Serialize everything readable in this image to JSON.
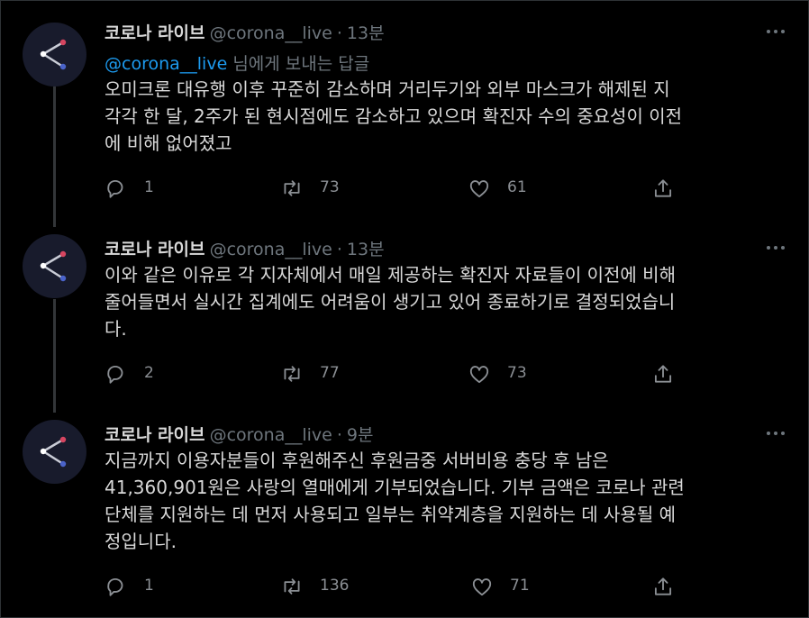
{
  "tweets": [
    {
      "name": "코로나 라이브",
      "handle": "@corona__live",
      "separator": "·",
      "time": "13분",
      "reply_to": {
        "mention": "@corona__live",
        "rest": "님에게 보내는 답글"
      },
      "lines": [
        "오미크론 대유행 이후 꾸준히 감소하며 거리두기와 외부 마스크가 해제된 지",
        "각각 한 달, 2주가 된 현시점에도 감소하고 있으며 확진자 수의 중요성이 이전",
        "에 비해 없어졌고"
      ],
      "stats": {
        "replies": "1",
        "retweets": "73",
        "likes": "61"
      }
    },
    {
      "name": "코로나 라이브",
      "handle": "@corona__live",
      "separator": "·",
      "time": "13분",
      "lines": [
        "이와 같은 이유로 각 지자체에서 매일 제공하는 확진자 자료들이 이전에 비해",
        "줄어들면서 실시간 집계에도 어려움이 생기고 있어 종료하기로 결정되었습니",
        "다."
      ],
      "stats": {
        "replies": "2",
        "retweets": "77",
        "likes": "73"
      }
    },
    {
      "name": "코로나 라이브",
      "handle": "@corona__live",
      "separator": "·",
      "time": "9분",
      "lines": [
        "지금까지 이용자분들이 후원해주신 후원금중 서버비용 충당 후 남은",
        "41,360,901원은 사랑의 열매에게 기부되었습니다. 기부 금액은 코로나 관련",
        "단체를 지원하는 데 먼저 사용되고 일부는 취약계층을 지원하는 데 사용될 예",
        "정입니다."
      ],
      "stats": {
        "replies": "1",
        "retweets": "136",
        "likes": "71"
      }
    }
  ],
  "icons": {
    "avatar": "network-share-icon",
    "reply": "reply-bubble-icon",
    "retweet": "retweet-icon",
    "like": "heart-icon",
    "share": "share-upload-icon",
    "more": "more-dots-icon"
  },
  "colors": {
    "background": "#000000",
    "text": "#d9d9d9",
    "muted": "#6e767d",
    "link": "#1d9bf0",
    "avatar_bg": "#181b2c",
    "node_red": "#d64560",
    "node_blue": "#4a63c9"
  }
}
